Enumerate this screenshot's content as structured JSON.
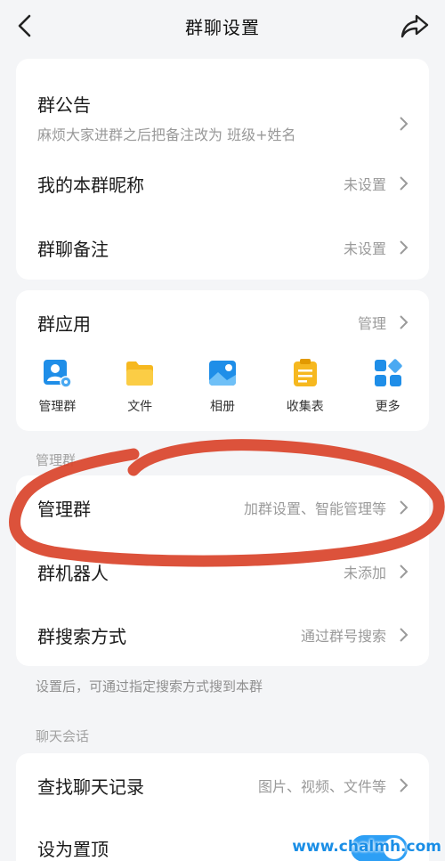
{
  "header": {
    "title": "群聊设置"
  },
  "notice": {
    "title": "群公告",
    "subtitle": "麻烦大家进群之后把备注改为 班级+姓名"
  },
  "nickname": {
    "label": "我的本群昵称",
    "value": "未设置"
  },
  "remark": {
    "label": "群聊备注",
    "value": "未设置"
  },
  "group_apps": {
    "label": "群应用",
    "value": "管理",
    "items": [
      {
        "label": "管理群",
        "icon": "manage-group-icon"
      },
      {
        "label": "文件",
        "icon": "folder-icon"
      },
      {
        "label": "相册",
        "icon": "album-icon"
      },
      {
        "label": "收集表",
        "icon": "clipboard-icon"
      },
      {
        "label": "更多",
        "icon": "more-apps-icon"
      }
    ]
  },
  "manage_section": {
    "label": "管理群",
    "manage": {
      "label": "管理群",
      "value": "加群设置、智能管理等"
    },
    "robot": {
      "label": "群机器人",
      "value": "未添加"
    },
    "search": {
      "label": "群搜索方式",
      "value": "通过群号搜索"
    },
    "hint": "设置后，可通过指定搜索方式搜到本群"
  },
  "chat_section": {
    "label": "聊天会话",
    "history": {
      "label": "查找聊天记录",
      "value": "图片、视频、文件等"
    },
    "pin": {
      "label": "设为置顶"
    }
  },
  "watermark": "www.chalmh.com",
  "colors": {
    "accent": "#2d9ff5",
    "annotation": "#d9432a",
    "icon_blue": "#1f8ee8",
    "icon_yellow": "#f6b81f"
  }
}
